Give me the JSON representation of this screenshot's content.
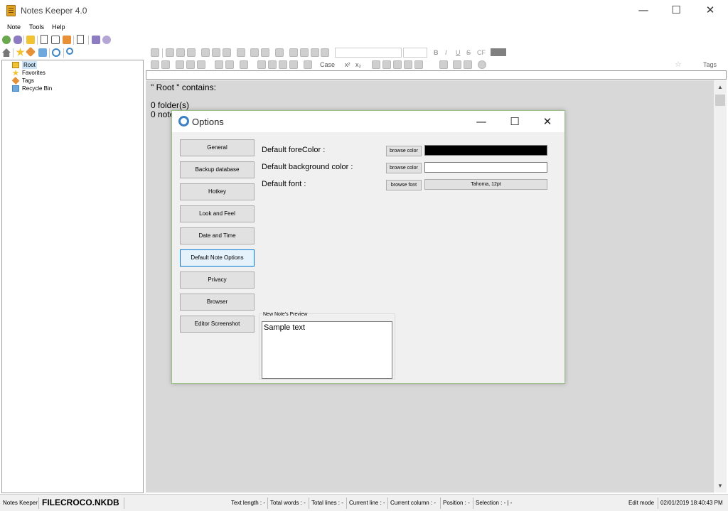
{
  "window": {
    "title": "Notes Keeper 4.0",
    "minimize_glyph": "—",
    "maximize_glyph": "☐",
    "close_glyph": "✕"
  },
  "menu": [
    "Note",
    "Tools",
    "Help"
  ],
  "tree": {
    "items": [
      {
        "label": "Root",
        "icon": "folder-icon",
        "selected": true
      },
      {
        "label": "Favorites",
        "icon": "star-icon"
      },
      {
        "label": "Tags",
        "icon": "tag-icon"
      },
      {
        "label": "Recycle Bin",
        "icon": "recycle-bin-icon"
      }
    ]
  },
  "editor_toolbar": {
    "case_label": "Case",
    "superscript_label": "x²",
    "subscript_label": "x₂",
    "bold_label": "B",
    "italic_label": "I",
    "underline_label": "U",
    "strike_label": "S",
    "cf_label": "CF",
    "tags_label": "Tags"
  },
  "editor": {
    "line1": "\" Root \" contains:",
    "line2": "0 folder(s)",
    "line3": "0 note"
  },
  "dialog": {
    "title": "Options",
    "minimize_glyph": "—",
    "maximize_glyph": "☐",
    "close_glyph": "✕",
    "nav": [
      {
        "label": "General"
      },
      {
        "label": "Backup database"
      },
      {
        "label": "Hotkey"
      },
      {
        "label": "Look and Feel"
      },
      {
        "label": "Date and Time"
      },
      {
        "label": "Default Note Options",
        "active": true
      },
      {
        "label": "Privacy"
      },
      {
        "label": "Browser"
      },
      {
        "label": "Editor Screenshot"
      }
    ],
    "fore_label": "Default foreColor :",
    "bg_label": "Default background color :",
    "font_label": "Default font :",
    "browse_color": "browse color",
    "browse_font": "browse font",
    "fore_color": "#000000",
    "bg_color": "#ffffff",
    "font_value": "Tahoma, 12pt",
    "preview_label": "New Note's Preview",
    "preview_text": "Sample text"
  },
  "status": {
    "app": "Notes Keeper",
    "db": "FILECROCO.NKDB",
    "text_length": "Text length : -",
    "total_words": "Total words : -",
    "total_lines": "Total lines : -",
    "current_line": "Current line : -",
    "current_column": "Current column : -",
    "position": "Position : -",
    "selection": "Selection : - | -",
    "mode": "Edit mode",
    "datetime": "02/01/2019 18:40:43 PM"
  }
}
